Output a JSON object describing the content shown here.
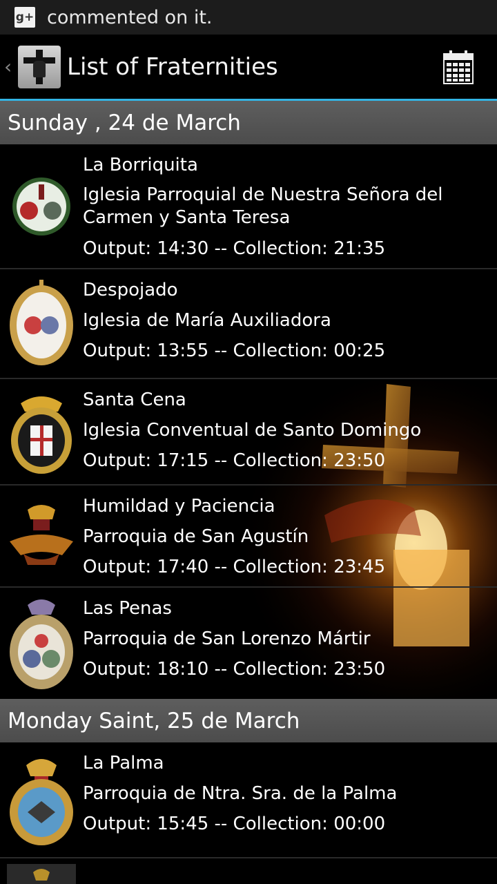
{
  "status_bar": {
    "notification_icon": "google-plus-icon",
    "text": "commented on it."
  },
  "action_bar": {
    "title": "List of Fraternities",
    "calendar_icon": "calendar-icon",
    "accent_color": "#33b5e5"
  },
  "sections": [
    {
      "header": "Sunday ,  24  de  March",
      "items": [
        {
          "name": "La Borriquita",
          "church": "Iglesia Parroquial de Nuestra Señora del Carmen y Santa Teresa",
          "times": "Output: 14:30 -- Collection: 21:35"
        },
        {
          "name": "Despojado",
          "church": "Iglesia de María Auxiliadora",
          "times": "Output: 13:55 -- Collection: 00:25"
        },
        {
          "name": "Santa Cena",
          "church": "Iglesia Conventual de Santo Domingo",
          "times": "Output: 17:15 -- Collection: 23:50"
        },
        {
          "name": "Humildad y Paciencia",
          "church": "Parroquia de San Agustín",
          "times": "Output: 17:40 -- Collection: 23:45"
        },
        {
          "name": "Las Penas",
          "church": "Parroquia de San Lorenzo Mártir",
          "times": "Output: 18:10 -- Collection: 23:50"
        }
      ]
    },
    {
      "header": "Monday Saint,  25  de  March",
      "items": [
        {
          "name": "La Palma",
          "church": "Parroquia de Ntra. Sra. de la Palma",
          "times": "Output: 15:45 -- Collection: 00:00"
        }
      ]
    }
  ]
}
